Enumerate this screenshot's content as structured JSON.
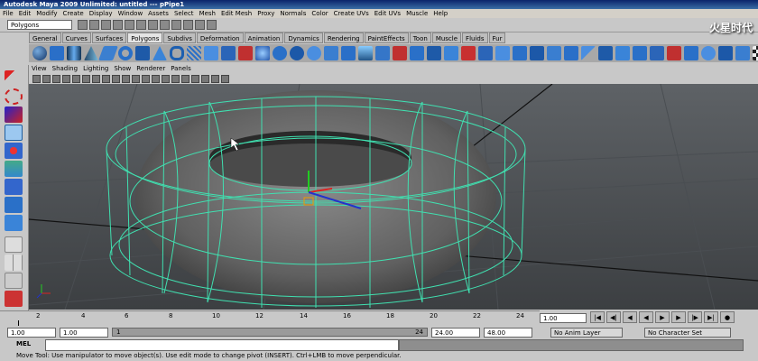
{
  "window": {
    "title": "Autodesk Maya 2009 Unlimited: untitled   ---   pPipe1"
  },
  "menu": [
    "File",
    "Edit",
    "Modify",
    "Create",
    "Display",
    "Window",
    "Assets",
    "Select",
    "Mesh",
    "Edit Mesh",
    "Proxy",
    "Normals",
    "Color",
    "Create UVs",
    "Edit UVs",
    "Muscle",
    "Help"
  ],
  "status_line": {
    "mode": "Polygons",
    "watermark": "火星时代"
  },
  "shelf_tabs": [
    {
      "label": "General",
      "active": false
    },
    {
      "label": "Curves",
      "active": false
    },
    {
      "label": "Surfaces",
      "active": false
    },
    {
      "label": "Polygons",
      "active": true
    },
    {
      "label": "Subdivs",
      "active": false
    },
    {
      "label": "Deformation",
      "active": false
    },
    {
      "label": "Animation",
      "active": false
    },
    {
      "label": "Dynamics",
      "active": false
    },
    {
      "label": "Rendering",
      "active": false
    },
    {
      "label": "PaintEffects",
      "active": false
    },
    {
      "label": "Toon",
      "active": false
    },
    {
      "label": "Muscle",
      "active": false
    },
    {
      "label": "Fluids",
      "active": false
    },
    {
      "label": "Fur",
      "active": false
    }
  ],
  "panel_menu": [
    "View",
    "Shading",
    "Lighting",
    "Show",
    "Renderer",
    "Panels"
  ],
  "time_slider": {
    "ticks": [
      "2",
      "4",
      "6",
      "8",
      "10",
      "12",
      "14",
      "16",
      "18",
      "20",
      "22",
      "24"
    ],
    "current_frame": "1.00"
  },
  "range": {
    "start": "1.00",
    "start_inner": "1.00",
    "start_display": "1",
    "end_display": "24",
    "end_inner": "24.00",
    "end": "48.00"
  },
  "anim_layer": "No Anim Layer",
  "character_set": "No Character Set",
  "command": {
    "label": "MEL"
  },
  "help_line": "Move Tool: Use manipulator to move object(s). Use edit mode to change pivot (INSERT). Ctrl+LMB to move perpendicular.",
  "colors": {
    "wireframe": "#40e0b0",
    "viewport_top": "#5e6266",
    "viewport_bottom": "#3c3f42",
    "torus": "#6e6e6e"
  }
}
